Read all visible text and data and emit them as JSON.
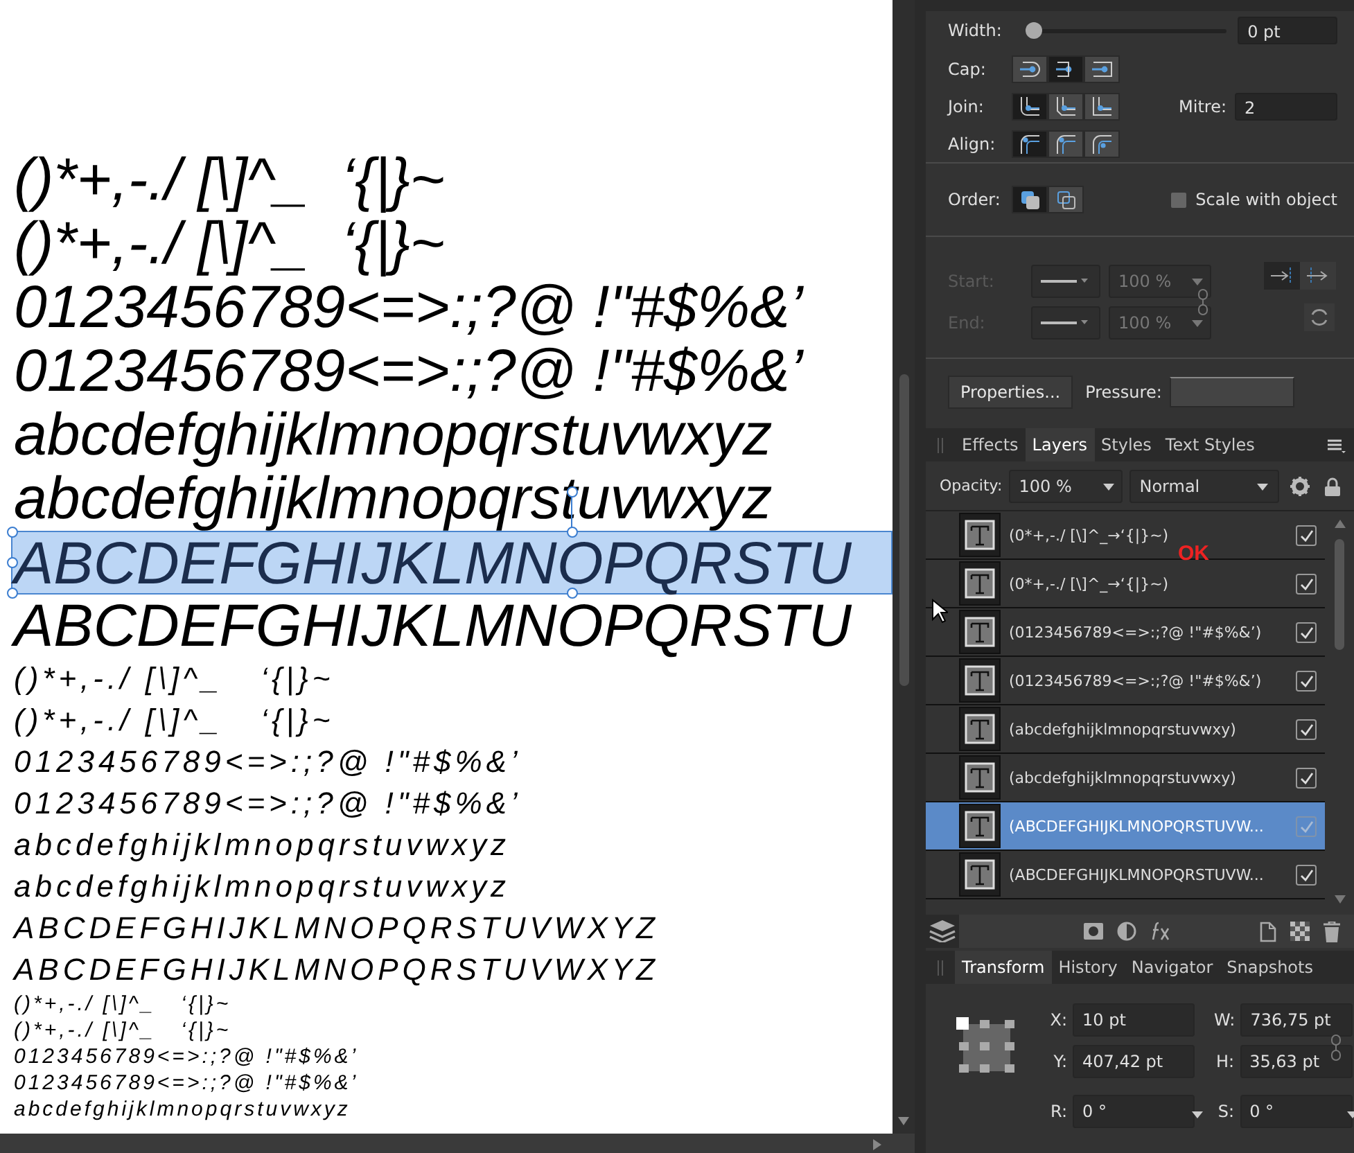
{
  "canvas": {
    "lines": [
      {
        "text": "()*+,-./ [\\]^_  ‘{|}~",
        "kind": "large",
        "selected": false
      },
      {
        "text": "()*+,-./ [\\]^_  ‘{|}~",
        "kind": "large",
        "selected": false
      },
      {
        "text": "0123456789<=>:;?@ !\"#$%&’",
        "kind": "large",
        "selected": false
      },
      {
        "text": "0123456789<=>:;?@ !\"#$%&’",
        "kind": "large",
        "selected": false
      },
      {
        "text": "abcdefghijklmnopqrstuvwxyz",
        "kind": "large",
        "selected": false
      },
      {
        "text": "abcdefghijklmnopqrstuvwxyz",
        "kind": "large",
        "selected": false
      },
      {
        "text": "ABCDEFGHIJKLMNOPQRSTU",
        "kind": "large",
        "selected": true
      },
      {
        "text": "ABCDEFGHIJKLMNOPQRSTU",
        "kind": "large",
        "selected": false
      },
      {
        "text": "()*+,-./ [\\]^_   ‘{|}~",
        "kind": "medium",
        "selected": false
      },
      {
        "text": "()*+,-./ [\\]^_   ‘{|}~",
        "kind": "medium",
        "selected": false
      },
      {
        "text": "0123456789<=>:;?@ !\"#$%&’",
        "kind": "medium",
        "selected": false
      },
      {
        "text": "0123456789<=>:;?@ !\"#$%&’",
        "kind": "medium",
        "selected": false
      },
      {
        "text": "abcdefghijklmnopqrstuvwxyz",
        "kind": "medium",
        "selected": false
      },
      {
        "text": "abcdefghijklmnopqrstuvwxyz",
        "kind": "medium",
        "selected": false
      },
      {
        "text": "ABCDEFGHIJKLMNOPQRSTUVWXYZ",
        "kind": "medium",
        "selected": false
      },
      {
        "text": "ABCDEFGHIJKLMNOPQRSTUVWXYZ",
        "kind": "medium",
        "selected": false
      },
      {
        "text": "()*+,-./ [\\]^_   ‘{|}~",
        "kind": "small",
        "selected": false
      },
      {
        "text": "()*+,-./ [\\]^_   ‘{|}~",
        "kind": "small",
        "selected": false
      },
      {
        "text": "0123456789<=>:;?@ !\"#$%&’",
        "kind": "small",
        "selected": false
      },
      {
        "text": "0123456789<=>:;?@ !\"#$%&’",
        "kind": "small",
        "selected": false
      },
      {
        "text": "abcdefghijklmnopqrstuvwxyz",
        "kind": "small",
        "selected": false
      }
    ]
  },
  "stroke": {
    "width": {
      "label": "Width:",
      "level": 0,
      "value": "0 pt"
    },
    "cap": {
      "label": "Cap:",
      "options": [
        {
          "selected": false
        },
        {
          "selected": true
        },
        {
          "selected": false
        }
      ]
    },
    "join": {
      "label": "Join:",
      "options": [
        {
          "selected": true
        },
        {
          "selected": false
        },
        {
          "selected": false
        }
      ]
    },
    "mitre": {
      "label": "Mitre:",
      "value": "2"
    },
    "align": {
      "label": "Align:",
      "options": [
        {
          "selected": true
        },
        {
          "selected": false
        },
        {
          "selected": false
        }
      ]
    },
    "order": {
      "label": "Order:",
      "options": [
        {
          "selected": true
        },
        {
          "selected": false
        }
      ]
    },
    "scale_with_object": {
      "label": "Scale with object",
      "checked": false
    },
    "arrows": [
      {
        "label": "Start:",
        "size": "100 %",
        "disabled": true
      },
      {
        "label": "End:",
        "size": "100 %",
        "disabled": true
      }
    ],
    "properties_button": "Properties...",
    "pressure_label": "Pressure:"
  },
  "layers_panel": {
    "tabs": [
      {
        "label": "Effects",
        "selected": false
      },
      {
        "label": "Layers",
        "selected": true
      },
      {
        "label": "Styles",
        "selected": false
      },
      {
        "label": "Text Styles",
        "selected": false
      }
    ],
    "opacity_label": "Opacity:",
    "opacity": "100 %",
    "blend_mode": "Normal",
    "layers": [
      {
        "name": "(0*+,-./ [\\]^_→‘{|}~)",
        "selected": false,
        "visible": true
      },
      {
        "name": "(0*+,-./ [\\]^_→‘{|}~)",
        "selected": false,
        "visible": true
      },
      {
        "name": "(0123456789<=>:;?@ !\"#$%&’)",
        "selected": false,
        "visible": true
      },
      {
        "name": "(0123456789<=>:;?@ !\"#$%&’)",
        "selected": false,
        "visible": true
      },
      {
        "name": "(abcdefghijklmnopqrstuvwxy)",
        "selected": false,
        "visible": true
      },
      {
        "name": "(abcdefghijklmnopqrstuvwxy)",
        "selected": false,
        "visible": true
      },
      {
        "name": "(ABCDEFGHIJKLMNOPQRSTUVW...",
        "selected": true,
        "visible": true
      },
      {
        "name": "(ABCDEFGHIJKLMNOPQRSTUVW...",
        "selected": false,
        "visible": true
      }
    ]
  },
  "annotation": "OK",
  "transform_panel": {
    "tabs": [
      {
        "label": "Transform",
        "selected": true
      },
      {
        "label": "History",
        "selected": false
      },
      {
        "label": "Navigator",
        "selected": false
      },
      {
        "label": "Snapshots",
        "selected": false
      }
    ],
    "fields": [
      {
        "label": "X:",
        "value": "10 pt",
        "kind": "text"
      },
      {
        "label": "W:",
        "value": "736,75 pt",
        "kind": "text"
      },
      {
        "label": "Y:",
        "value": "407,42 pt",
        "kind": "text"
      },
      {
        "label": "H:",
        "value": "35,63 pt",
        "kind": "text"
      },
      {
        "label": "R:",
        "value": "0 °",
        "kind": "dropdown"
      },
      {
        "label": "S:",
        "value": "0 °",
        "kind": "dropdown"
      }
    ]
  }
}
